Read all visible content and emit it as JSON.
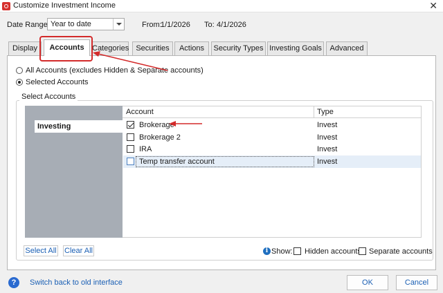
{
  "window": {
    "title": "Customize Investment Income",
    "close_glyph": "✕",
    "icon": "app-logo-icon"
  },
  "date_range": {
    "label": "Date Range:",
    "value": "Year to date",
    "from_label": "From:",
    "from_value": "1/1/2026",
    "to_label": "To:",
    "to_value": "4/1/2026"
  },
  "tabs": [
    {
      "label": "Display"
    },
    {
      "label": "Accounts",
      "active": true
    },
    {
      "label": "Categories"
    },
    {
      "label": "Securities"
    },
    {
      "label": "Actions"
    },
    {
      "label": "Security Types"
    },
    {
      "label": "Investing Goals"
    },
    {
      "label": "Advanced"
    }
  ],
  "options": {
    "all_accounts": "All Accounts (excludes Hidden & Separate accounts)",
    "selected_accounts": "Selected Accounts",
    "selected": "selected_accounts"
  },
  "select_accounts": {
    "legend": "Select Accounts",
    "groups": [
      {
        "label": "Investing"
      }
    ],
    "columns": {
      "account": "Account",
      "type": "Type"
    },
    "rows": [
      {
        "name": "Brokerage",
        "type": "Invest",
        "checked": true
      },
      {
        "name": "Brokerage 2",
        "type": "Invest",
        "checked": false
      },
      {
        "name": "IRA",
        "type": "Invest",
        "checked": false
      },
      {
        "name": "Temp transfer account",
        "type": "Invest",
        "checked": false,
        "selected": true
      }
    ]
  },
  "footer_controls": {
    "select_all": "Select All",
    "clear_all": "Clear All",
    "show_label": "Show:",
    "info_glyph": "i",
    "hidden_accounts": "Hidden accounts",
    "separate_accounts": "Separate accounts"
  },
  "bottom": {
    "help_glyph": "?",
    "switch_link": "Switch back to old interface",
    "ok": "OK",
    "cancel": "Cancel"
  },
  "colors": {
    "annotation_red": "#d32a2a",
    "link_blue": "#1a5fb4",
    "sidebar_gray": "#a7adb5",
    "selection_blue": "#e5eef8"
  }
}
